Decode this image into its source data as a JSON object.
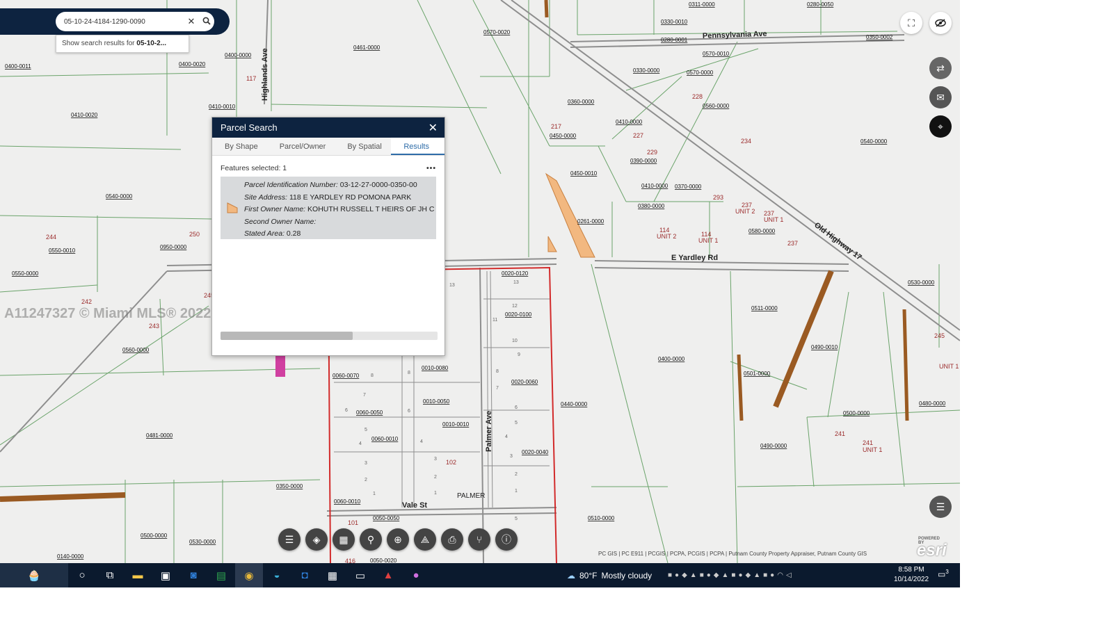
{
  "search": {
    "value": "05-10-24-4184-1290-0090",
    "suggestion_prefix": "Show search results for ",
    "suggestion_bold": "05-10-2..."
  },
  "panel": {
    "title": "Parcel Search",
    "tabs": [
      "By Shape",
      "Parcel/Owner",
      "By Spatial",
      "Results"
    ],
    "features_selected": "Features selected: 1",
    "more": "•••",
    "result": {
      "pin_label": "Parcel Identification Number:",
      "pin_value": "03-12-27-0000-0350-00",
      "address_label": "Site Address:",
      "address_value": "118 E YARDLEY RD POMONA PARK",
      "owner_label": "First Owner Name:",
      "owner_value": "KOHUTH RUSSELL T HEIRS OF JH C",
      "owner2_label": "Second Owner Name:",
      "owner2_value": "",
      "area_label": "Stated Area:",
      "area_value": "0.28"
    }
  },
  "map": {
    "roads": {
      "pennsylvania": "Pennsylvania Ave",
      "highlands": "Highlands Ave",
      "yardley": "E Yardley Rd",
      "old_highway": "Old Highway 17",
      "palmer_ave": "Palmer Ave",
      "vale": "Vale St",
      "palmer": "PALMER"
    },
    "parcels": [
      "0311-0000",
      "0280-0050",
      "0330-0010",
      "0280-0001",
      "0350-0002",
      "0570-0020",
      "0461-0000",
      "0400-0000",
      "0400-0020",
      "0400-0011",
      "0410-0010",
      "0410-0020",
      "0570-0010",
      "0360-0000",
      "0330-0000",
      "0570-0000",
      "0560-0000",
      "0410-0000",
      "0450-0000",
      "0390-0000",
      "0450-0010",
      "0410-0000",
      "0370-0000",
      "0380-0000",
      "0540-0000",
      "0540-0000",
      "0261-0000",
      "0580-0000",
      "0950-0000",
      "0550-0010",
      "0550-0000",
      "0020-0120",
      "0511-0000",
      "0530-0000",
      "0020-0100",
      "0560-0000",
      "0490-0010",
      "0400-0000",
      "0501-0000",
      "0060-0070",
      "0010-0080",
      "0020-0060",
      "0010-0050",
      "0440-0000",
      "0500-0000",
      "0480-0000",
      "0060-0050",
      "0010-0010",
      "0060-0010",
      "0481-0000",
      "0020-0040",
      "0490-0000",
      "0350-0000",
      "0060-0010",
      "0510-0000",
      "0500-0000",
      "0530-0000",
      "0050-0050",
      "0140-0000",
      "0050-0020"
    ],
    "numbers": [
      "117",
      "228",
      "217",
      "227",
      "229",
      "234",
      "244",
      "250",
      "293",
      "237",
      "237",
      "242",
      "243",
      "245",
      "114",
      "114",
      "237",
      "241",
      "241",
      "245",
      "102",
      "101",
      "416"
    ],
    "unit_labels": [
      "UNIT 2",
      "UNIT 1",
      "UNIT 2",
      "UNIT 1",
      "UNIT 1",
      "UNIT 1"
    ],
    "colors": {
      "parcel_line": "#5a9a5a",
      "road": "#9a9a9a",
      "highlight_orange": "#f2b880",
      "brown_strip": "#9a5a22",
      "selection": "#d22a2a",
      "pink": "#d040a0"
    }
  },
  "toolbar_icons": [
    "list-icon",
    "layers-icon",
    "grid-icon",
    "locate-icon",
    "globe-icon",
    "measure-icon",
    "print-icon",
    "share-icon",
    "info-icon"
  ],
  "right_buttons": [
    "fullscreen-icon",
    "hide-icon",
    "transfer-icon",
    "mail-icon",
    "select-icon",
    "list-icon"
  ],
  "attribution": "PC GIS | PC E911 | PCGIS | PCPA, PCGIS | PCPA | Putnam County Property Appraiser, Putnam County GIS",
  "esri": {
    "powered": "POWERED BY",
    "logo": "esri"
  },
  "watermark": "A11247327 © Miami MLS® 2022",
  "taskbar": {
    "weather_temp": "80°F",
    "weather_text": "Mostly cloudy",
    "time": "8:58 PM",
    "date": "10/14/2022",
    "notifications": "3"
  }
}
